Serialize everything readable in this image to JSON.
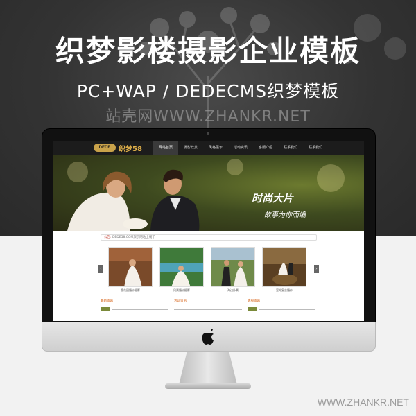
{
  "promo": {
    "headline": "织梦影楼摄影企业模板",
    "subline": "PC+WAP / DEDECMS织梦模板",
    "watermark": "站壳网WWW.ZHANKR.NET",
    "corner_watermark": "WWW.ZHANKR.NET"
  },
  "site": {
    "logo_badge": "DEDE",
    "logo_name": "织梦58",
    "nav": [
      "网站首页",
      "摄影欣赏",
      "风格展示",
      "活动资讯",
      "客服介绍",
      "联系我们",
      "联系我们"
    ],
    "banner": {
      "title": "时尚大片",
      "subtitle": "故事为你而编"
    },
    "notice": {
      "label": "公告:",
      "text": "DEDE58.COM演示网站上线了"
    },
    "gallery": {
      "prev": "‹",
      "next": "›",
      "items": [
        {
          "caption": "樱花园婚纱摄影"
        },
        {
          "caption": "风景婚纱摄影"
        },
        {
          "caption": "海边外景"
        },
        {
          "caption": "室外复古婚纱"
        }
      ]
    },
    "lists": [
      {
        "title": "最新资讯"
      },
      {
        "title": "活动资讯"
      },
      {
        "title": "客服资讯"
      }
    ]
  },
  "colors": {
    "banner_dark": "#2a2c14",
    "accent_gold": "#e0b04a",
    "list_head": "#d35400"
  }
}
